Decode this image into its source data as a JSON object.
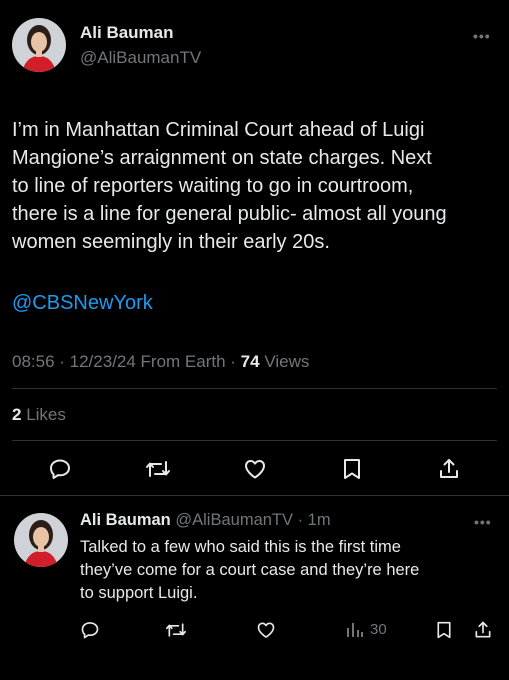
{
  "main_tweet": {
    "author_name": "Ali Bauman",
    "handle": "@AliBaumanTV",
    "text_lines": [
      "I’m in Manhattan Criminal Court ahead of Luigi",
      "Mangione’s arraignment on state charges. Next",
      "to line of reporters waiting to go in courtroom,",
      "there is a line for general public- almost all young",
      "women seemingly in their early 20s."
    ],
    "mention": "@CBSNewYork",
    "meta_time_date": "08:56 · 12/23/24 From Earth · ",
    "views_count": "74",
    "views_label": " Views",
    "likes_count": "2",
    "likes_label": "Likes",
    "more": "•••"
  },
  "reply": {
    "author_name": "Ali Bauman",
    "handle_time": "@AliBaumanTV · 1m",
    "text_lines": [
      "Talked to a few who said this is the first time",
      "they’ve come for a court case and they’re here",
      "to support Luigi."
    ],
    "views_count": "30",
    "more": "•••"
  },
  "colors": {
    "background": "#000000",
    "text": "#e7e9ea",
    "secondary": "#71767b",
    "link": "#1d9bf0",
    "divider": "#2f3336"
  }
}
